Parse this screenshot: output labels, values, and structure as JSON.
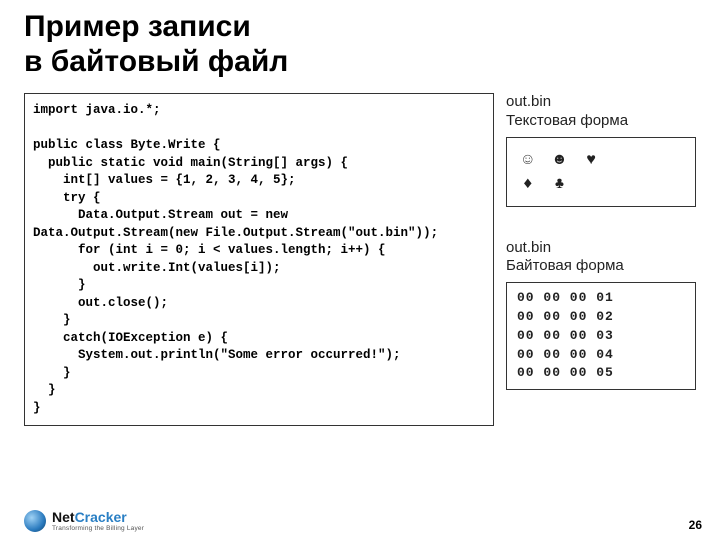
{
  "title_line1": "Пример записи",
  "title_line2": "в байтовый файл",
  "code": "import java.io.*;\n\npublic class Byte.Write {\n  public static void main(String[] args) {\n    int[] values = {1, 2, 3, 4, 5};\n    try {\n      Data.Output.Stream out = new\nData.Output.Stream(new File.Output.Stream(\"out.bin\"));\n      for (int i = 0; i < values.length; i++) {\n        out.write.Int(values[i]);\n      }\n      out.close();\n    }\n    catch(IOException e) {\n      System.out.println(\"Some error occurred!\");\n    }\n  }\n}",
  "textform": {
    "label_line1": "out.bin",
    "label_line2": "Текстовая форма",
    "row1": "☺☻♥",
    "row2": "♦♣"
  },
  "byteform": {
    "label_line1": "out.bin",
    "label_line2": "Байтовая форма",
    "rows": [
      "00 00 00 01",
      "00 00 00 02",
      "00 00 00 03",
      "00 00 00 04",
      "00 00 00 05"
    ]
  },
  "footer": {
    "logo_name_net": "Net",
    "logo_name_cracker": "Cracker",
    "logo_tagline": "Transforming the Billing Layer",
    "page_number": "26"
  }
}
